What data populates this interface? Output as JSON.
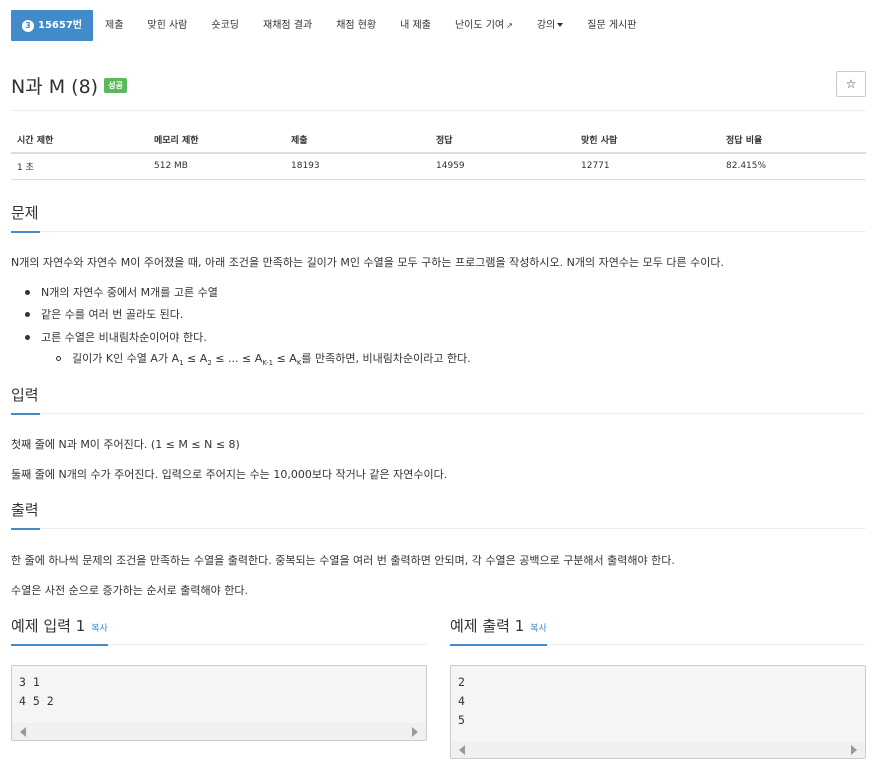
{
  "nav": {
    "problem_tab": "15657번",
    "medal": "3",
    "tabs": [
      "제출",
      "맞힌 사람",
      "숏코딩",
      "재채점 결과",
      "채점 현황",
      "내 제출",
      "난이도 기여",
      "강의"
    ]
  },
  "title": "N과 M (8)",
  "badge": "성공",
  "star": "☆",
  "info": {
    "headers": [
      "시간 제한",
      "메모리 제한",
      "제출",
      "정답",
      "맞힌 사람",
      "정답 비율"
    ],
    "values": [
      "1 초",
      "512 MB",
      "18193",
      "14959",
      "12771",
      "82.415%"
    ]
  },
  "problem": {
    "heading": "문제",
    "text": "N개의 자연수와 자연수 M이 주어졌을 때, 아래 조건을 만족하는 길이가 M인 수열을 모두 구하는 프로그램을 작성하시오. N개의 자연수는 모두 다른 수이다.",
    "bullets": [
      "N개의 자연수 중에서 M개를 고른 수열",
      "같은 수를 여러 번 골라도 된다.",
      "고른 수열은 비내림차순이어야 한다."
    ],
    "sub_bullet": {
      "pre": "길이가 K인 수열 A가 A",
      "s1": "1",
      "m1": " ≤ A",
      "s2": "2",
      "m2": " ≤ ... ≤ A",
      "s3": "K-1",
      "m3": " ≤ A",
      "s4": "K",
      "post": "를 만족하면, 비내림차순이라고 한다."
    }
  },
  "input": {
    "heading": "입력",
    "lines": [
      "첫째 줄에 N과 M이 주어진다. (1 ≤ M ≤ N ≤ 8)",
      "둘째 줄에 N개의 수가 주어진다. 입력으로 주어지는 수는 10,000보다 작거나 같은 자연수이다."
    ]
  },
  "output": {
    "heading": "출력",
    "lines": [
      "한 줄에 하나씩 문제의 조건을 만족하는 수열을 출력한다. 중복되는 수열을 여러 번 출력하면 안되며, 각 수열은 공백으로 구분해서 출력해야 한다.",
      "수열은 사전 순으로 증가하는 순서로 출력해야 한다."
    ]
  },
  "example_input": {
    "heading": "예제 입력 1",
    "copy": "복사",
    "lines": [
      "3 1",
      "4 5 2"
    ]
  },
  "example_output": {
    "heading": "예제 출력 1",
    "copy": "복사",
    "lines": [
      "2",
      "4",
      "5"
    ]
  },
  "colors": {
    "primary": "#428bca",
    "success": "#5cb85c"
  }
}
